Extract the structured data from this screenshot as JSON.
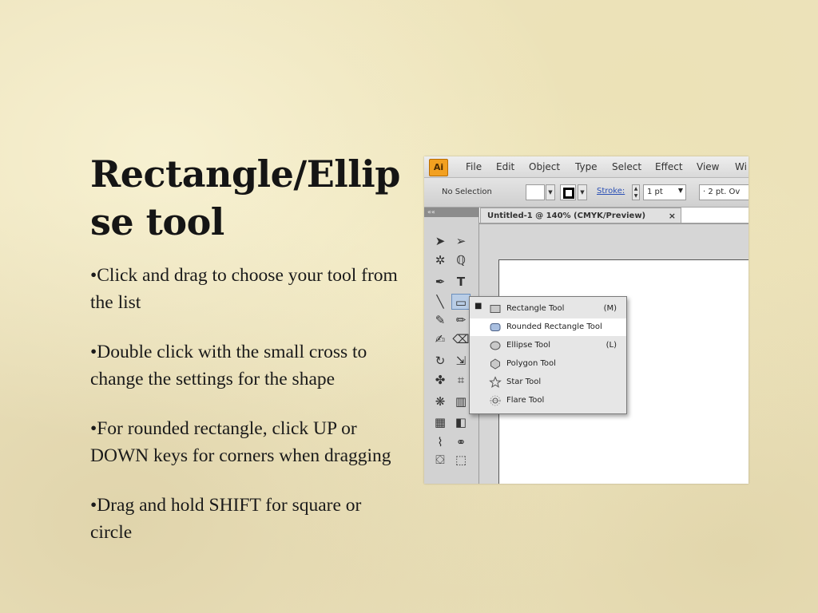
{
  "slide": {
    "title": "Rectangle/Ellipse tool",
    "bullets": [
      "Click and drag to choose your tool from the list",
      "Double click with the small cross to change the settings for the shape",
      "For rounded rectangle, click UP or DOWN keys for corners when dragging",
      "Drag and hold SHIFT for square or circle"
    ]
  },
  "screenshot": {
    "app_logo": "Ai",
    "menu": [
      "File",
      "Edit",
      "Object",
      "Type",
      "Select",
      "Effect",
      "View",
      "Wi"
    ],
    "control_bar": {
      "selection": "No Selection",
      "stroke_label": "Stroke:",
      "stroke_weight": "1 pt",
      "brush": "2 pt. Ov"
    },
    "document_tab": "Untitled-1 @ 140% (CMYK/Preview)",
    "close_glyph": "×",
    "panel_head": "««",
    "flyout": [
      {
        "label": "Rectangle Tool",
        "shortcut": "(M)",
        "selected": true
      },
      {
        "label": "Rounded Rectangle Tool",
        "shortcut": "",
        "hover": true
      },
      {
        "label": "Ellipse Tool",
        "shortcut": "(L)"
      },
      {
        "label": "Polygon Tool",
        "shortcut": ""
      },
      {
        "label": "Star Tool",
        "shortcut": ""
      },
      {
        "label": "Flare Tool",
        "shortcut": ""
      }
    ],
    "colors": {
      "logo": "#f2a020",
      "active_tool": "#b9cde6",
      "stroke_link": "#2a4fb5"
    }
  }
}
